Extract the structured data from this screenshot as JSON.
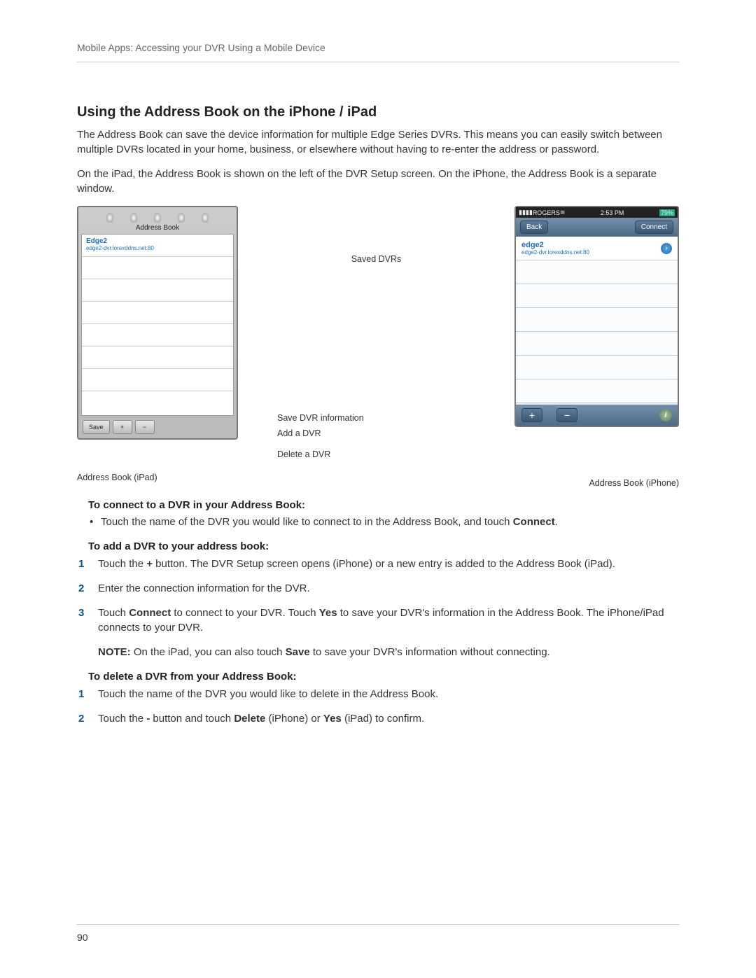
{
  "header": {
    "breadcrumb": "Mobile Apps: Accessing your DVR Using a Mobile Device"
  },
  "title": "Using the Address Book on the iPhone / iPad",
  "para1": "The Address Book can save the device information for multiple Edge Series DVRs. This means you can easily switch between multiple DVRs located in your home, business, or elsewhere without having to re-enter the address or password.",
  "para2": "On the iPad, the Address Book is shown on the left of the DVR Setup screen. On the iPhone, the Address Book is a separate window.",
  "ipad": {
    "title": "Address Book",
    "row": {
      "name": "Edge2",
      "addr": "edge2-dvr.lorexddns.net:80"
    },
    "save": "Save",
    "plus": "+",
    "minus": "−",
    "caption": "Address Book (iPad)"
  },
  "labels": {
    "saved": "Saved DVRs",
    "saveinfo": "Save DVR information",
    "add": "Add a DVR",
    "delete": "Delete a DVR"
  },
  "iphone": {
    "carrier": "ROGERS",
    "wifi": "≋",
    "time": "2:53 PM",
    "battery": "79%",
    "back": "Back",
    "connect": "Connect",
    "row": {
      "name": "edge2",
      "addr": "edge2-dvr.lorexddns.net:80"
    },
    "plus": "+",
    "minus": "−",
    "caption": "Address Book (iPhone)"
  },
  "sub1": "To connect to a DVR in your Address Book:",
  "bullet1_a": "Touch the name of the DVR you would like to connect to in the Address Book, and touch ",
  "bullet1_b": "Connect",
  "bullet1_c": ".",
  "sub2": "To add a DVR to your address book:",
  "steps_add": {
    "s1a": "Touch the ",
    "s1b": "+",
    "s1c": " button. The DVR Setup screen opens (iPhone) or a new entry is added to the Address Book (iPad).",
    "s2": "Enter the connection information for the DVR.",
    "s3a": "Touch ",
    "s3b": "Connect",
    "s3c": " to connect to your DVR. Touch ",
    "s3d": "Yes",
    "s3e": " to save your DVR's information in the Address Book. The iPhone/iPad connects to your DVR."
  },
  "note_a": "NOTE:",
  "note_b": " On the iPad, you can also touch ",
  "note_c": "Save",
  "note_d": " to save your DVR's information without connecting.",
  "sub3": "To delete a DVR from your Address Book:",
  "steps_del": {
    "s1": "Touch the name of the DVR you would like to delete in the Address Book.",
    "s2a": "Touch the ",
    "s2b": "-",
    "s2c": " button and touch ",
    "s2d": "Delete",
    "s2e": " (iPhone) or ",
    "s2f": "Yes",
    "s2g": " (iPad) to confirm."
  },
  "pagenum": "90"
}
